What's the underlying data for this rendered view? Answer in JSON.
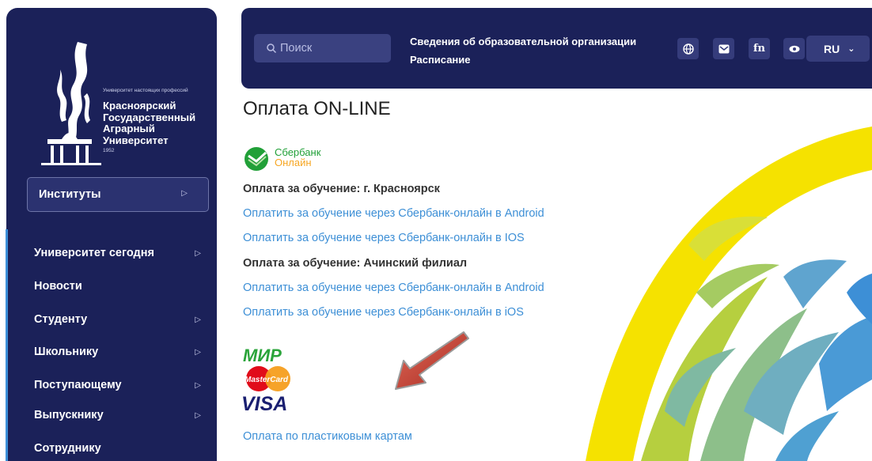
{
  "sidebar": {
    "logo": {
      "tagline": "Университет настоящих профессий",
      "name": "Красноярский Государственный Аграрный Университет",
      "year": "1952"
    },
    "institutes_label": "Институты",
    "menu": [
      {
        "label": "Университет сегодня",
        "has_arrow": true
      },
      {
        "label": "Новости",
        "has_arrow": false
      },
      {
        "label": "Студенту",
        "has_arrow": true
      },
      {
        "label": "Школьнику",
        "has_arrow": true
      },
      {
        "label": "Поступающему",
        "has_arrow": true
      },
      {
        "label": "Выпускнику",
        "has_arrow": true
      },
      {
        "label": "Сотруднику",
        "has_arrow": false
      }
    ]
  },
  "header": {
    "search_placeholder": "Поиск",
    "link_info": "Сведения об образовательной организации",
    "link_schedule": "Расписание",
    "icons": [
      "globe-icon",
      "mail-icon",
      "fn-icon",
      "eye-icon"
    ],
    "language": "RU"
  },
  "main": {
    "title": "Оплата ON-LINE",
    "sber_logo": {
      "line1": "Сбербанк",
      "line2": "Онлайн"
    },
    "section1": "Оплата за обучение: г. Красноярск",
    "link1": "Оплатить за обучение через Сбербанк-онлайн в Android",
    "link2": "Оплатить за обучение через Сбербанк-онлайн в IOS",
    "section2": "Оплата за обучение: Ачинский филиал",
    "link3": "Оплатить за обучение через Сбербанк-онлайн в Android",
    "link4": "Оплатить за обучение через Сбербанк-онлайн в iOS",
    "cards_logos": [
      "МИР",
      "MasterCard",
      "VISA"
    ],
    "card_payment_link": "Оплата по пластиковым картам"
  },
  "colors": {
    "navy": "#1b2159",
    "link": "#3d8fd6",
    "sber_green": "#21a038",
    "arrow_red": "#c0392b"
  }
}
